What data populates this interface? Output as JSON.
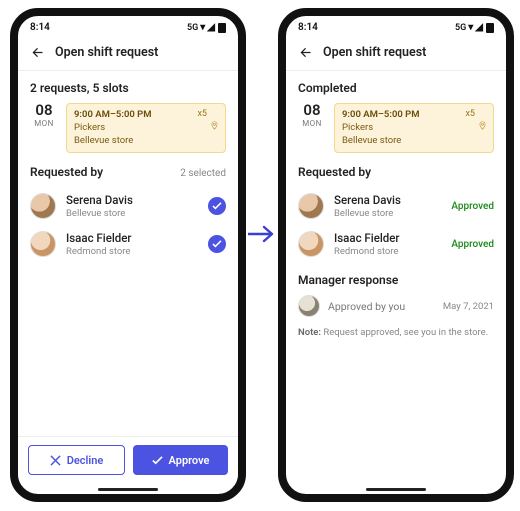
{
  "status": {
    "time": "8:14",
    "network": "5G"
  },
  "topbar": {
    "title": "Open shift request"
  },
  "shift": {
    "date_num": "08",
    "date_dow": "MON",
    "time": "9:00 AM–5:00 PM",
    "role": "Pickers",
    "location": "Bellevue store",
    "slots_badge": "x5"
  },
  "left": {
    "summary": "2 requests, 5 slots",
    "section_title": "Requested by",
    "section_sub": "2 selected",
    "people": [
      {
        "name": "Serena Davis",
        "sub": "Bellevue store"
      },
      {
        "name": "Isaac Fielder",
        "sub": "Redmond store"
      }
    ],
    "decline_label": "Decline",
    "approve_label": "Approve"
  },
  "right": {
    "summary": "Completed",
    "section_title": "Requested by",
    "approved_label": "Approved",
    "people": [
      {
        "name": "Serena Davis",
        "sub": "Bellevue store"
      },
      {
        "name": "Isaac Fielder",
        "sub": "Redmond store"
      }
    ],
    "mgr_section": "Manager response",
    "mgr_text": "Approved by you",
    "mgr_date": "May 7, 2021",
    "note_label": "Note:",
    "note_text": "Request approved, see you in the store."
  }
}
